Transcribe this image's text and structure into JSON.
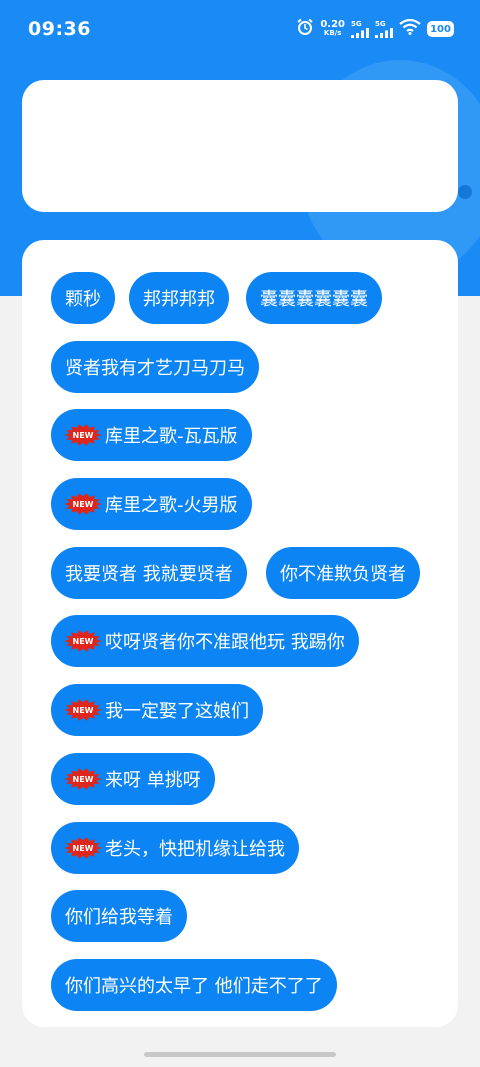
{
  "status_bar": {
    "time": "09:36",
    "speed_value": "0.20",
    "speed_unit": "KB/s",
    "sig1": "5G",
    "sig2": "5G",
    "battery": "100"
  },
  "badge_text": "NEW",
  "buttons": [
    {
      "label": "颗秒",
      "new": false
    },
    {
      "label": "邦邦邦邦",
      "new": false
    },
    {
      "label": "囊囊囊囊囊囊",
      "new": false
    },
    {
      "label": "贤者我有才艺刀马刀马",
      "new": false
    },
    {
      "label": "库里之歌-瓦瓦版",
      "new": true
    },
    {
      "label": "库里之歌-火男版",
      "new": true
    },
    {
      "label": "我要贤者 我就要贤者",
      "new": false
    },
    {
      "label": "你不准欺负贤者",
      "new": false
    },
    {
      "label": "哎呀贤者你不准跟他玩   我踢你",
      "new": true
    },
    {
      "label": "我一定娶了这娘们",
      "new": true
    },
    {
      "label": "来呀 单挑呀",
      "new": true
    },
    {
      "label": "老头，快把机缘让给我",
      "new": true
    },
    {
      "label": "你们给我等着",
      "new": false
    },
    {
      "label": "你们高兴的太早了  他们走不了了",
      "new": false
    }
  ],
  "colors": {
    "accent": "#1a8af5",
    "chip": "#0c84f3",
    "badge": "#e0261b"
  }
}
